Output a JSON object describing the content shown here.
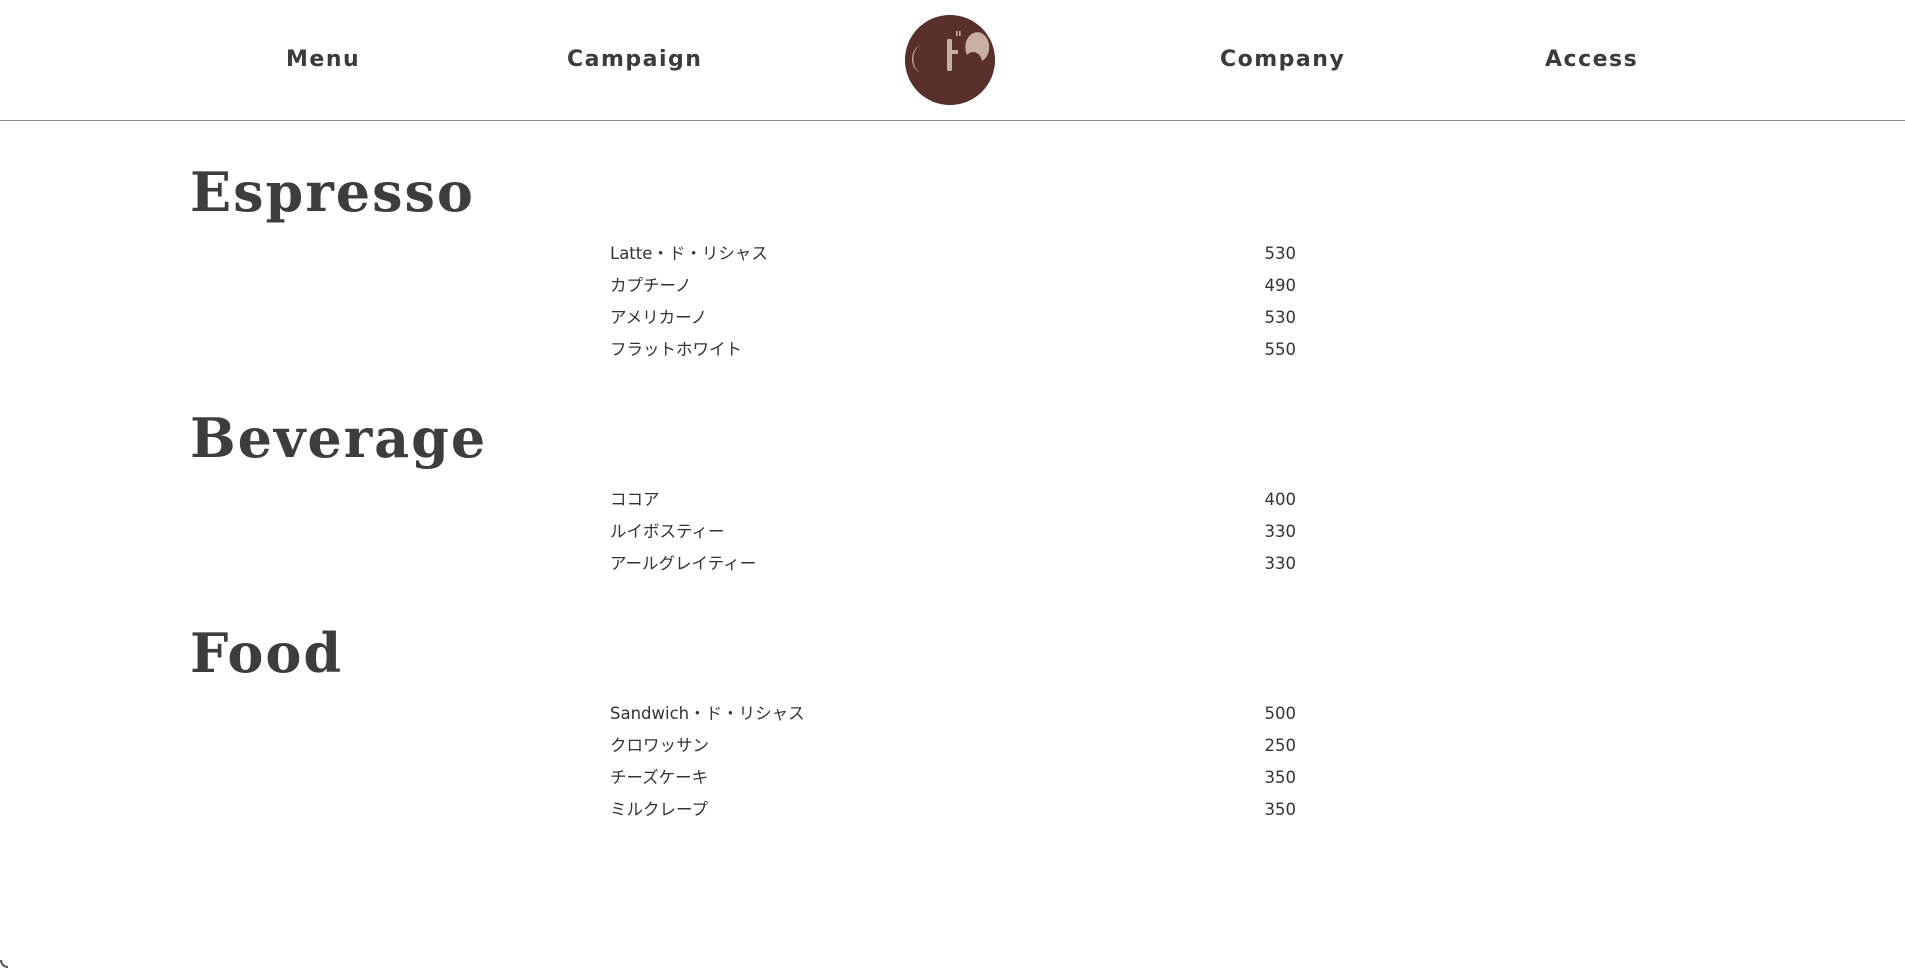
{
  "header": {
    "nav": {
      "menu": "Menu",
      "campaign": "Campaign",
      "company": "Company",
      "access": "Access"
    },
    "logo_icon": "cafe-logo-icon",
    "logo_color": "#58302b",
    "logo_mark_color": "#c9aea3"
  },
  "sections": [
    {
      "title": "Espresso",
      "items": [
        {
          "name": "Latte・ド・リシャス",
          "price": "530"
        },
        {
          "name": "カプチーノ",
          "price": "490"
        },
        {
          "name": "アメリカーノ",
          "price": "530"
        },
        {
          "name": "フラットホワイト",
          "price": "550"
        }
      ]
    },
    {
      "title": "Beverage",
      "items": [
        {
          "name": "ココア",
          "price": "400"
        },
        {
          "name": "ルイボスティー",
          "price": "330"
        },
        {
          "name": "アールグレイティー",
          "price": "330"
        }
      ]
    },
    {
      "title": "Food",
      "items": [
        {
          "name": "Sandwich・ド・リシャス",
          "price": "500"
        },
        {
          "name": "クロワッサン",
          "price": "250"
        },
        {
          "name": "チーズケーキ",
          "price": "350"
        },
        {
          "name": "ミルクレープ",
          "price": "350"
        }
      ]
    }
  ]
}
